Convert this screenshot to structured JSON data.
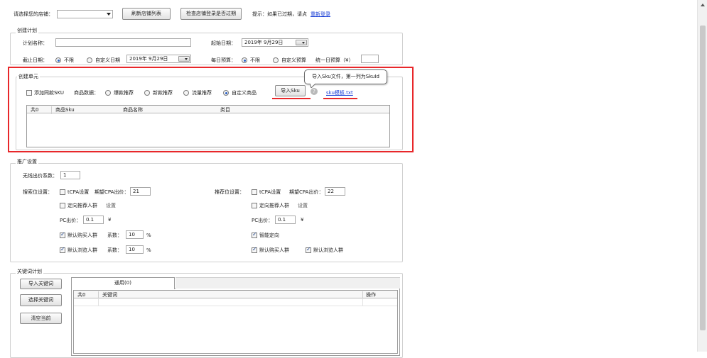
{
  "top": {
    "store_label": "请选择您的店铺：",
    "store_value": "",
    "refresh_btn": "刷新店铺列表",
    "check_login_btn": "检查店铺登录是否过期",
    "hint_text": "提示：如果已过期，请点",
    "relogin_link": "重新登录"
  },
  "plan": {
    "section_title": "创建计划",
    "name_label": "计划名称：",
    "name_value": "",
    "start_label": "起始日期：",
    "start_value": "2019年 9月29日",
    "end_label": "截止日期：",
    "end_opt_unlimited": "不限",
    "end_opt_custom": "自定义日期",
    "end_date_value": "2019年 9月29日",
    "budget_label": "每日预算：",
    "budget_opt_unlimited": "不限",
    "budget_opt_custom": "自定义预算",
    "unified_budget_label": "统一日预算（¥）",
    "unified_budget_value": ""
  },
  "unit": {
    "section_title": "创建单元",
    "add_sync_label": "添加同款SKU",
    "product_data_label": "商品数据：",
    "opt_hot": "爆款推荐",
    "opt_new": "新款推荐",
    "opt_traffic": "流量推荐",
    "opt_custom": "自定义商品",
    "import_btn": "导入Sku",
    "help_icon_glyph": "?",
    "template_link": "sku模板.txt",
    "tooltip": "导入Sku文件，第一列为SkuId",
    "grid_headers": [
      "共0",
      "商品Sku",
      "商品名称",
      "类目"
    ]
  },
  "promo": {
    "section_title": "推广设置",
    "coef_label": "无线出价系数：",
    "coef_value": "1",
    "search_label": "搜索位设置：",
    "search": {
      "tcpa_label": "tCPA设置",
      "cpa_label": "期望CPA出价：",
      "cpa_value": "21",
      "directed_label": "定向推荐人群",
      "settings_link": "设置",
      "pc_label": "PC出价：",
      "pc_value": "0.1",
      "yuan": "¥",
      "default_buy_label": "默认购买人群",
      "coef_label_1": "系数：",
      "coef_value_1": "10",
      "pct_1": "%",
      "default_browse_label": "默认浏览人群",
      "coef_label_2": "系数：",
      "coef_value_2": "10",
      "pct_2": "%"
    },
    "recommend_label": "推荐位设置：",
    "recommend": {
      "tcpa_label": "tCPA设置",
      "cpa_label": "期望CPA出价：",
      "cpa_value": "22",
      "directed_label": "定向推荐人群",
      "settings_link": "设置",
      "pc_label": "PC出价：",
      "pc_value": "0.1",
      "yuan": "¥",
      "smart_label": "智能定向",
      "default_buy_label": "默认购买人群",
      "default_browse_label": "默认浏览人群"
    }
  },
  "keywords": {
    "section_title": "关键词计划",
    "import_btn": "导入关键词",
    "select_btn": "选择关键词",
    "clear_btn": "清空当前",
    "tab_label": "通用(0)",
    "grid_headers": [
      "共0",
      "关键词",
      "操作"
    ]
  },
  "colors": {
    "highlight_border": "#e8272a",
    "link": "#1a3fd6",
    "radio_dot": "#2a62c9"
  }
}
